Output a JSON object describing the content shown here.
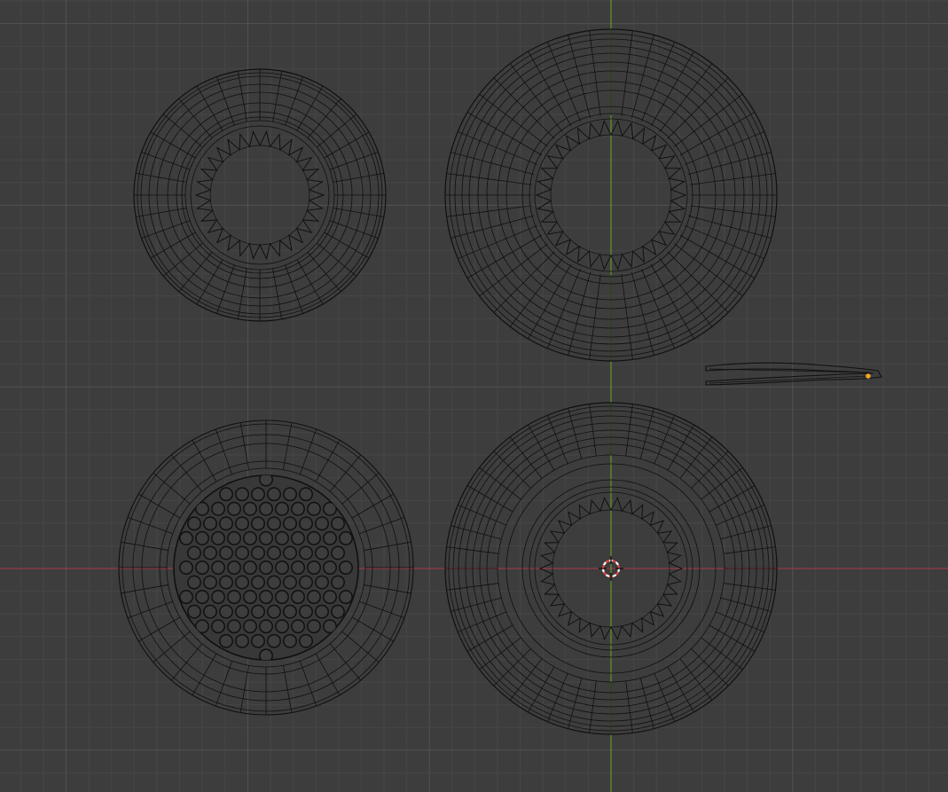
{
  "app": {
    "view": "orthographic-top",
    "shading": "wireframe"
  },
  "colors": {
    "background": "#3d3d3d",
    "grid_minor": "#464646",
    "grid_major": "#525252",
    "axis_x": "#8a3a47",
    "axis_y": "#5f8a2a",
    "wire": "#101010",
    "origin_dot": "#f5a623",
    "cursor_red": "#e04545",
    "cursor_white": "#ffffff"
  },
  "objects": [
    {
      "id": "ring-top-left",
      "kind": "toothed-ring",
      "selected": false
    },
    {
      "id": "ring-top-right",
      "kind": "toothed-ring",
      "selected": false
    },
    {
      "id": "tweezers",
      "kind": "tweezers",
      "selected": false
    },
    {
      "id": "mesh-grid-disc",
      "kind": "perforated-disc",
      "selected": false
    },
    {
      "id": "ring-bottom-right",
      "kind": "toothed-ring",
      "selected": false
    }
  ],
  "cursor": {
    "name": "3d-cursor"
  }
}
